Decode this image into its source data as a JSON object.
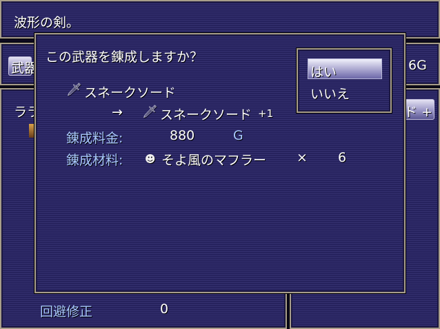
{
  "help_text": "波形の剣。",
  "bg": {
    "weapon_tab": "武器",
    "gold_frag": "6G",
    "char_frag": "ララ",
    "item_frag": "ド +",
    "stat_label": "回避修正",
    "stat_value": "0"
  },
  "dialog": {
    "question": "この武器を錬成しますか？",
    "source_item": "スネークソード",
    "arrow": "→",
    "result_item": "スネークソード",
    "result_plus": "+1",
    "fee_label": "錬成料金:",
    "fee_value": "880",
    "fee_unit": "G",
    "material_label": "錬成材料:",
    "material_name": "そよ風のマフラー",
    "material_times": "×",
    "material_qty": "6"
  },
  "choices": [
    "はい",
    "いいえ"
  ],
  "selected_choice": 0,
  "colors": {
    "window_bg": "#2a2668",
    "window_border": "#a89e8a",
    "label_blue": "#a9c8ff",
    "text": "#ffffff"
  },
  "icons": {
    "weapon": "sword-icon",
    "material": "skull-icon"
  }
}
